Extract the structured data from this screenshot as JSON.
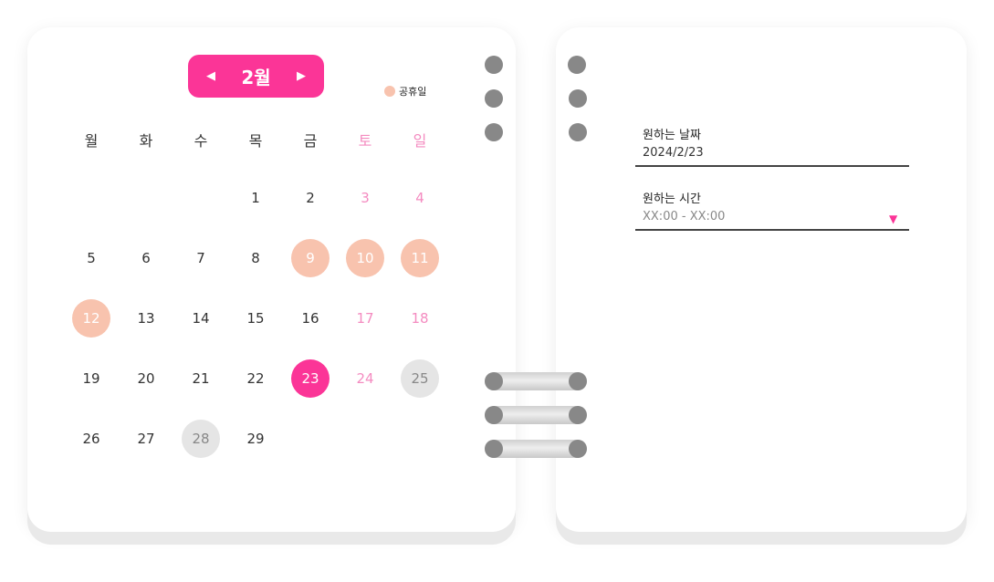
{
  "calendar": {
    "month_label": "2월",
    "prev_icon": "◀",
    "next_icon": "▶",
    "legend_label": "공휴일",
    "weekdays": [
      "월",
      "화",
      "수",
      "목",
      "금",
      "토",
      "일"
    ],
    "colors": {
      "accent": "#fb3597",
      "holiday": "#f8c3ae",
      "weekend_text": "#f48bc0",
      "disabled": "#e5e5e5"
    },
    "days": [
      {
        "label": "1",
        "col": 3,
        "row": 0,
        "state": "normal"
      },
      {
        "label": "2",
        "col": 4,
        "row": 0,
        "state": "normal"
      },
      {
        "label": "3",
        "col": 5,
        "row": 0,
        "state": "weekend"
      },
      {
        "label": "4",
        "col": 6,
        "row": 0,
        "state": "weekend"
      },
      {
        "label": "5",
        "col": 0,
        "row": 1,
        "state": "normal"
      },
      {
        "label": "6",
        "col": 1,
        "row": 1,
        "state": "normal"
      },
      {
        "label": "7",
        "col": 2,
        "row": 1,
        "state": "normal"
      },
      {
        "label": "8",
        "col": 3,
        "row": 1,
        "state": "normal"
      },
      {
        "label": "9",
        "col": 4,
        "row": 1,
        "state": "holiday"
      },
      {
        "label": "10",
        "col": 5,
        "row": 1,
        "state": "holiday"
      },
      {
        "label": "11",
        "col": 6,
        "row": 1,
        "state": "holiday"
      },
      {
        "label": "12",
        "col": 0,
        "row": 2,
        "state": "holiday"
      },
      {
        "label": "13",
        "col": 1,
        "row": 2,
        "state": "normal"
      },
      {
        "label": "14",
        "col": 2,
        "row": 2,
        "state": "normal"
      },
      {
        "label": "15",
        "col": 3,
        "row": 2,
        "state": "normal"
      },
      {
        "label": "16",
        "col": 4,
        "row": 2,
        "state": "normal"
      },
      {
        "label": "17",
        "col": 5,
        "row": 2,
        "state": "weekend"
      },
      {
        "label": "18",
        "col": 6,
        "row": 2,
        "state": "weekend"
      },
      {
        "label": "19",
        "col": 0,
        "row": 3,
        "state": "normal"
      },
      {
        "label": "20",
        "col": 1,
        "row": 3,
        "state": "normal"
      },
      {
        "label": "21",
        "col": 2,
        "row": 3,
        "state": "normal"
      },
      {
        "label": "22",
        "col": 3,
        "row": 3,
        "state": "normal"
      },
      {
        "label": "23",
        "col": 4,
        "row": 3,
        "state": "selected"
      },
      {
        "label": "24",
        "col": 5,
        "row": 3,
        "state": "weekend"
      },
      {
        "label": "25",
        "col": 6,
        "row": 3,
        "state": "disabled"
      },
      {
        "label": "26",
        "col": 0,
        "row": 4,
        "state": "normal"
      },
      {
        "label": "27",
        "col": 1,
        "row": 4,
        "state": "normal"
      },
      {
        "label": "28",
        "col": 2,
        "row": 4,
        "state": "disabled"
      },
      {
        "label": "29",
        "col": 3,
        "row": 4,
        "state": "normal"
      }
    ]
  },
  "form": {
    "date_label": "원하는 날짜",
    "date_value": "2024/2/23",
    "time_label": "원하는 시간",
    "time_placeholder": "XX:00 - XX:00",
    "dropdown_icon": "▼"
  }
}
